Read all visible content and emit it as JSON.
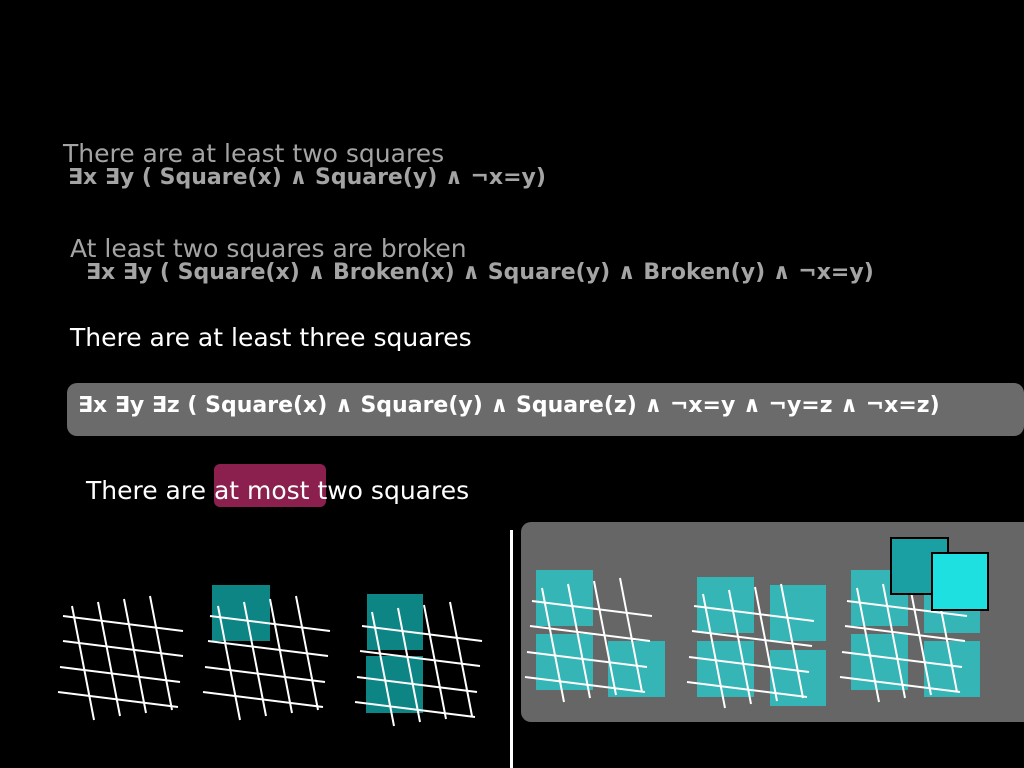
{
  "lines": {
    "l1_text": "There are at least two squares",
    "l1_formula": "∃x ∃y ( Square(x) ∧ Square(y) ∧ ¬x=y)",
    "l2_text": "At least two squares are broken",
    "l2_formula": "∃x ∃y ( Square(x) ∧ Broken(x) ∧ Square(y) ∧ Broken(y) ∧ ¬x=y)",
    "l3_text": "There are at least three squares",
    "l3_formula": "∃x ∃y ∃z ( Square(x) ∧ Square(y) ∧ Square(z) ∧ ¬x=y ∧ ¬y=z ∧ ¬x=z)",
    "l4_before": "There are",
    "l4_highlight": "at most",
    "l4_after": "two squares"
  },
  "colors": {
    "background": "#000000",
    "dim_text": "#a4a4a4",
    "highlight": "#8b1f4e",
    "square_dark": "#0d8585",
    "square_light": "#35b5b5",
    "square_bright": "#1ee0e0",
    "panel": "#666666"
  },
  "figures": {
    "left_examples": [
      {
        "squares": 0
      },
      {
        "squares": 1
      },
      {
        "squares": 2
      }
    ],
    "right_examples": [
      {
        "squares": 3
      },
      {
        "squares": 4
      },
      {
        "squares": 5
      }
    ]
  }
}
